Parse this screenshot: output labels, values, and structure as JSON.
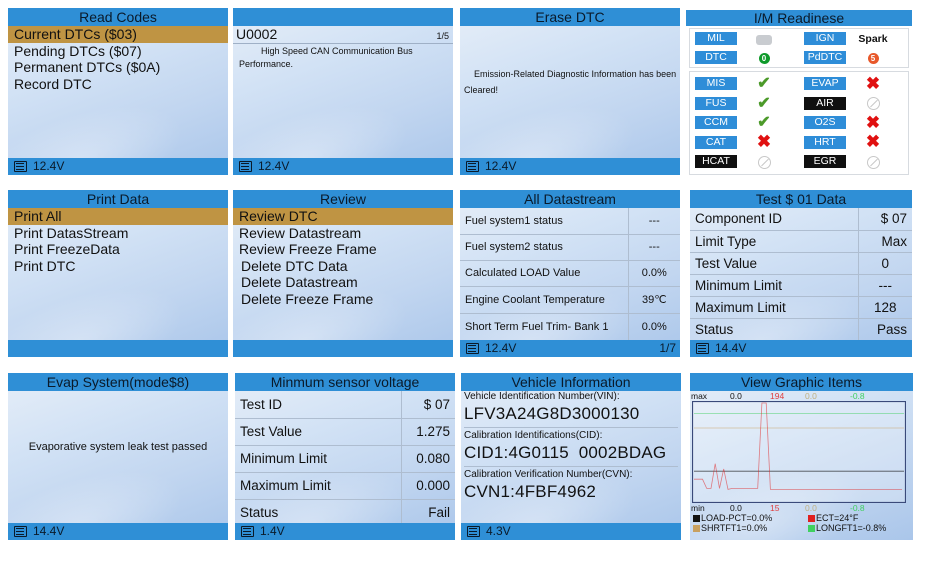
{
  "colors": {
    "title_bar": "#2f8fd6",
    "selected_row": "#bf9443",
    "label_blue": "#2e8dd8",
    "pass_green": "#4c9a2a",
    "fail_red": "#e01010"
  },
  "panels": {
    "read_codes": {
      "title": "Read Codes",
      "items": [
        "Current DTCs ($03)",
        "Pending DTCs ($07)",
        "Permanent DTCs ($0A)",
        "Record DTC"
      ],
      "selected_index": 0,
      "voltage": "12.4V"
    },
    "dtc_detail": {
      "title": "",
      "code": "U0002",
      "index": "1/5",
      "description": "High Speed  CAN Communication Bus Performance.",
      "voltage": "12.4V"
    },
    "erase_dtc": {
      "title": "Erase DTC",
      "message": "Emission-Related Diagnostic Information has been Cleared!",
      "voltage": "12.4V"
    },
    "im_readiness": {
      "title": "I/M Readinese",
      "top": [
        {
          "label": "MIL",
          "status": "engine-off",
          "label2": "IGN",
          "status2_text": "Spark"
        },
        {
          "label": "DTC",
          "count": "0",
          "count_color": "#0f9a2a",
          "label2": "PdDTC",
          "count2": "5",
          "count2_color": "#e8582a"
        }
      ],
      "monitors": [
        {
          "label": "MIS",
          "dark": false,
          "status": "complete",
          "label2": "EVAP",
          "dark2": false,
          "status2": "incomplete"
        },
        {
          "label": "FUS",
          "dark": false,
          "status": "complete",
          "label2": "AIR",
          "dark2": true,
          "status2": "not-supported"
        },
        {
          "label": "CCM",
          "dark": false,
          "status": "complete",
          "label2": "O2S",
          "dark2": false,
          "status2": "incomplete"
        },
        {
          "label": "CAT",
          "dark": false,
          "status": "incomplete",
          "label2": "HRT",
          "dark2": false,
          "status2": "incomplete"
        },
        {
          "label": "HCAT",
          "dark": true,
          "status": "not-supported",
          "label2": "EGR",
          "dark2": true,
          "status2": "not-supported"
        }
      ],
      "icons": {
        "complete": "✔",
        "incomplete": "✖"
      }
    },
    "print_data": {
      "title": "Print Data",
      "items": [
        "Print All",
        "Print DatasStream",
        "Print FreezeData",
        "Print DTC"
      ],
      "selected_index": 0
    },
    "review": {
      "title": "Review",
      "items": [
        "Review DTC",
        "Review Datastream",
        "Review Freeze Frame",
        "Delete DTC Data",
        "Delete Datastream",
        "Delete Freeze Frame"
      ],
      "selected_index": 0
    },
    "all_datastream": {
      "title": "All Datastream",
      "rows": [
        {
          "name": "Fuel system1 status",
          "value": "---"
        },
        {
          "name": "Fuel system2 status",
          "value": "---"
        },
        {
          "name": "Calculated LOAD Value",
          "value": "0.0%"
        },
        {
          "name": "Engine Coolant Temperature",
          "value": "39℃"
        },
        {
          "name": "Short Term Fuel Trim- Bank 1",
          "value": "0.0%"
        }
      ],
      "voltage": "12.4V",
      "page": "1/7"
    },
    "test01": {
      "title": "Test $ 01 Data",
      "rows": [
        {
          "name": "Component ID",
          "value": "$ 07"
        },
        {
          "name": "Limit Type",
          "value": "Max"
        },
        {
          "name": "Test Value",
          "value": "0"
        },
        {
          "name": "Minimum Limit",
          "value": "---"
        },
        {
          "name": "Maximum Limit",
          "value": "128"
        },
        {
          "name": "Status",
          "value": "Pass"
        }
      ],
      "voltage": "14.4V"
    },
    "evap": {
      "title": "Evap System(mode$8)",
      "message": "Evaporative system leak test passed",
      "voltage": "14.4V"
    },
    "min_sensor": {
      "title": "Minmum sensor voltage",
      "rows": [
        {
          "name": "Test ID",
          "value": "$ 07"
        },
        {
          "name": "Test Value",
          "value": "1.275"
        },
        {
          "name": "Minimum Limit",
          "value": "0.080"
        },
        {
          "name": "Maximum Limit",
          "value": "0.000"
        },
        {
          "name": "Status",
          "value": "Fail"
        }
      ],
      "voltage": "1.4V"
    },
    "vehicle_info": {
      "title": "Vehicle Information",
      "vin_label": "Vehicle Identification Number(VIN):",
      "vin": "LFV3A24G8D3000130",
      "cid_label": "Calibration Identifications(CID):",
      "cid": "CID1:4G0115  0002BDAG",
      "cvn_label": "Calibration Verification Number(CVN):",
      "cvn": "CVN1:4FBF4962",
      "voltage": "4.3V"
    },
    "graph": {
      "title": "View Graphic Items"
    }
  },
  "chart_data": {
    "type": "line",
    "title": "View Graphic Items",
    "max_label": "max",
    "min_label": "min",
    "series": [
      {
        "name": "LOAD-PCT",
        "legend": "LOAD-PCT=0.0%",
        "color": "#111111",
        "max": "0.0",
        "min": "0.0",
        "max_color": "#111111",
        "min_color": "#111111",
        "level": 0.3,
        "values": []
      },
      {
        "name": "ECT",
        "legend": "ECT=24°F",
        "color": "#e02020",
        "max": "194",
        "min": "15",
        "max_color": "#e04040",
        "min_color": "#e04040",
        "values": [
          40,
          40,
          40,
          22,
          22,
          70,
          22,
          60,
          20,
          22,
          22,
          22,
          22,
          22,
          22,
          22,
          194,
          194,
          20,
          20,
          20,
          20,
          20,
          20,
          20,
          20,
          20,
          20,
          20,
          20,
          20,
          20,
          20,
          20,
          20,
          20,
          20,
          20,
          20,
          20,
          20,
          20,
          20,
          20,
          20,
          20,
          20,
          20,
          20,
          20
        ]
      },
      {
        "name": "SHRTFT1",
        "legend": "SHRTFT1=0.0%",
        "color": "#c8a060",
        "max": "0.0",
        "min": "0.0",
        "max_color": "#c0b080",
        "min_color": "#c0b080",
        "level": 0.75,
        "values": []
      },
      {
        "name": "LONGFT1",
        "legend": "LONGFT1=-0.8%",
        "color": "#40d060",
        "max": "-0.8",
        "min": "-0.8",
        "max_color": "#40d060",
        "min_color": "#40d060",
        "level": 0.9,
        "values": []
      }
    ],
    "y_range": [
      15,
      194
    ]
  }
}
